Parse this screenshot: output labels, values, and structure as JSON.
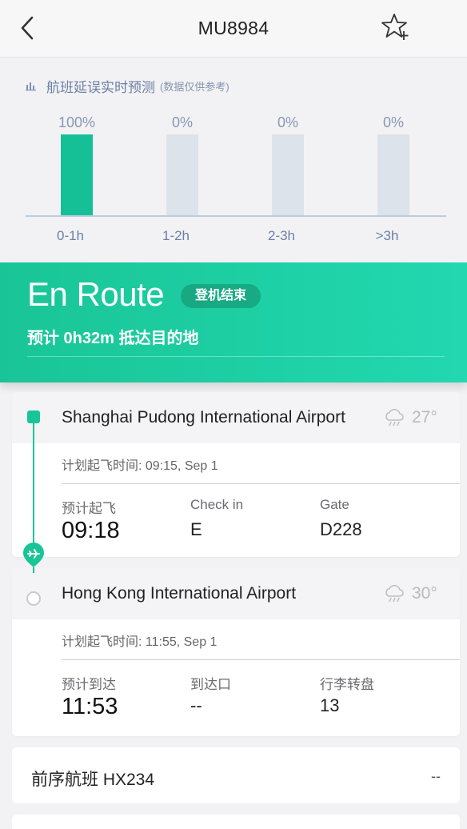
{
  "header": {
    "title": "MU8984"
  },
  "prediction": {
    "title": "航班延误实时预测",
    "subtitle": "(数据仅供参考)",
    "accent_color": "#16c096",
    "inactive_color": "#dde3ea"
  },
  "chart_data": {
    "type": "bar",
    "categories": [
      "0-1h",
      "1-2h",
      "2-3h",
      ">3h"
    ],
    "values": [
      100,
      0,
      0,
      0
    ],
    "value_labels": [
      "100%",
      "0%",
      "0%",
      "0%"
    ],
    "ylim": [
      0,
      100
    ],
    "grid": false
  },
  "status": {
    "main": "En Route",
    "badge": "登机结束",
    "eta": "预计 0h32m 抵达目的地"
  },
  "departure": {
    "airport": "Shanghai Pudong International Airport",
    "weather_icon": "cloud-rain-icon",
    "temp": "27°",
    "scheduled": "计划起飞时间: 09:15, Sep 1",
    "col1_label": "预计起飞",
    "col1_value": "09:18",
    "col2_label": "Check in",
    "col2_value": "E",
    "col3_label": "Gate",
    "col3_value": "D228"
  },
  "arrival": {
    "airport": "Hong Kong International Airport",
    "weather_icon": "cloud-rain-icon",
    "temp": "30°",
    "scheduled": "计划起飞时间: 11:55, Sep 1",
    "col1_label": "预计到达",
    "col1_value": "11:53",
    "col2_label": "到达口",
    "col2_value": "--",
    "col3_label": "行李转盘",
    "col3_value": "13"
  },
  "previous_flight": {
    "label": "前序航班 HX234",
    "value": "--"
  }
}
